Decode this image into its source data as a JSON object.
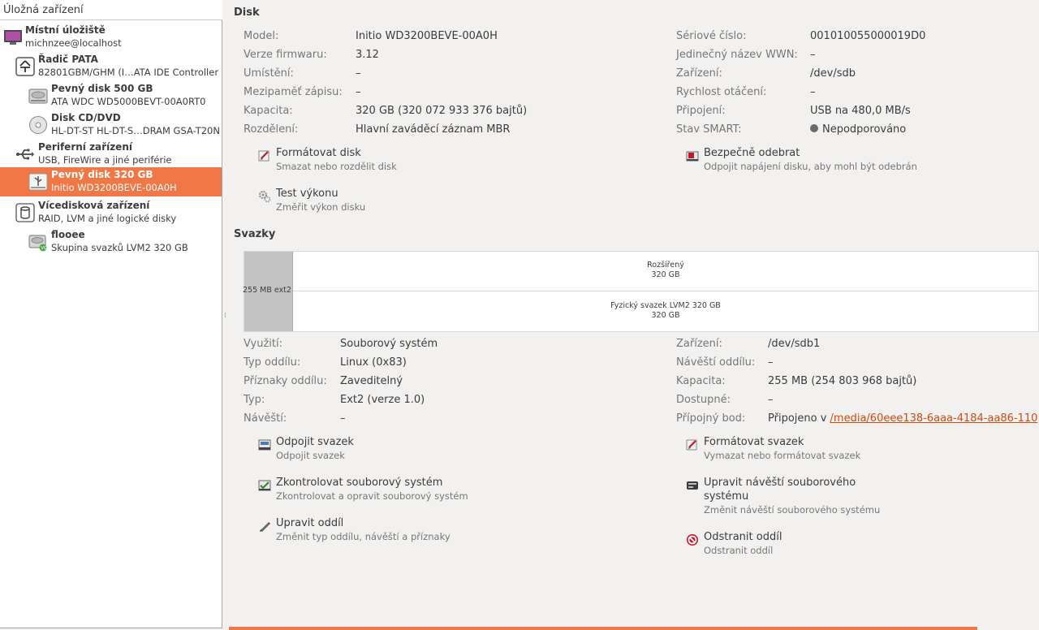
{
  "sidebar": {
    "header": "Úložná zařízení",
    "items": [
      {
        "name": "Místní úložiště",
        "desc": "michnzee@localhost",
        "icon": "computer-icon"
      },
      {
        "name": "Řadič PATA",
        "desc": "82801GBM/GHM (I…ATA IDE Controller",
        "icon": "controller-icon"
      },
      {
        "name": "Pevný disk 500 GB",
        "desc": "ATA WDC WD5000BEVT-00A0RT0",
        "icon": "harddisk-icon"
      },
      {
        "name": "Disk CD/DVD",
        "desc": "HL-DT-ST HL-DT-S…DRAM GSA-T20N",
        "icon": "optical-disc-icon"
      },
      {
        "name": "Periferní zařízení",
        "desc": "USB, FireWire a jiné periférie",
        "icon": "usb-icon"
      },
      {
        "name": "Pevný disk 320 GB",
        "desc": "Initio WD3200BEVE-00A0H",
        "icon": "usb-harddisk-icon"
      },
      {
        "name": "Vícedisková zařízení",
        "desc": "RAID, LVM a jiné logické disky",
        "icon": "raid-icon"
      },
      {
        "name": "flooee",
        "desc": "Skupina svazků LVM2 320 GB",
        "icon": "lvm-volume-group-icon"
      }
    ]
  },
  "disk": {
    "title": "Disk",
    "left": [
      {
        "label": "Model:",
        "value": "Initio WD3200BEVE-00A0H"
      },
      {
        "label": "Verze firmwaru:",
        "value": "3.12"
      },
      {
        "label": "Umístění:",
        "value": "–"
      },
      {
        "label": "Mezipaměť zápisu:",
        "value": "–"
      },
      {
        "label": "Kapacita:",
        "value": "320 GB (320 072 933 376 bajtů)"
      },
      {
        "label": "Rozdělení:",
        "value": "Hlavní zaváděcí záznam MBR"
      }
    ],
    "right": [
      {
        "label": "Sériové číslo:",
        "value": "001010055000019D0"
      },
      {
        "label": "Jedinečný název WWN:",
        "value": "–"
      },
      {
        "label": "Zařízení:",
        "value": "/dev/sdb"
      },
      {
        "label": "Rychlost otáčení:",
        "value": "–"
      },
      {
        "label": "Připojení:",
        "value": "USB na 480,0 MB/s"
      },
      {
        "label": "Stav SMART:",
        "value": "Nepodporováno"
      }
    ],
    "actions": {
      "format": {
        "title": "Formátovat disk",
        "desc": "Smazat nebo rozdělit disk"
      },
      "benchmark": {
        "title": "Test výkonu",
        "desc": "Změřit výkon disku"
      },
      "safe_remove": {
        "title": "Bezpečně odebrat",
        "desc": "Odpojit napájení disku, aby mohl být odebrán"
      }
    }
  },
  "volumes": {
    "title": "Svazky",
    "map": {
      "partition1": "255 MB ext2",
      "extended_name": "Rozšířený",
      "extended_size": "320 GB",
      "lvm_name": "Fyzický svazek LVM2 320 GB",
      "lvm_size": "320 GB"
    },
    "left": [
      {
        "label": "Využití:",
        "value": "Souborový systém"
      },
      {
        "label": "Typ oddílu:",
        "value": "Linux (0x83)"
      },
      {
        "label": "Příznaky oddílu:",
        "value": "Zaveditelný"
      },
      {
        "label": "Typ:",
        "value": "Ext2 (verze 1.0)"
      },
      {
        "label": "Návěští:",
        "value": "–"
      }
    ],
    "right": [
      {
        "label": "Zařízení:",
        "value": "/dev/sdb1"
      },
      {
        "label": "Návěští oddílu:",
        "value": "–"
      },
      {
        "label": "Kapacita:",
        "value": "255 MB (254 803 968 bajtů)"
      },
      {
        "label": "Dostupné:",
        "value": "–"
      },
      {
        "label": "Přípojný bod:",
        "value": "Připojeno v ",
        "link": "/media/60eee138-6aaa-4184-aa86-110"
      }
    ],
    "actions": {
      "unmount": {
        "title": "Odpojit svazek",
        "desc": "Odpojit svazek"
      },
      "check": {
        "title": "Zkontrolovat souborový systém",
        "desc": "Zkontrolovat a opravit souborový systém"
      },
      "edit_partition": {
        "title": "Upravit oddíl",
        "desc": "Změnit typ oddílu, návěští a příznaky"
      },
      "format_volume": {
        "title": "Formátovat svazek",
        "desc": "Vymazat nebo formátovat svazek"
      },
      "edit_label_line1": "Upravit návěští souborového",
      "edit_label_line2": "systému",
      "edit_label_desc": "Změnit návěští souborového systému",
      "delete_partition": {
        "title": "Odstranit oddíl",
        "desc": "Odstranit oddíl"
      }
    }
  },
  "colors": {
    "accent": "#f07746",
    "link": "#d24a0e",
    "delete": "#c7162b"
  }
}
